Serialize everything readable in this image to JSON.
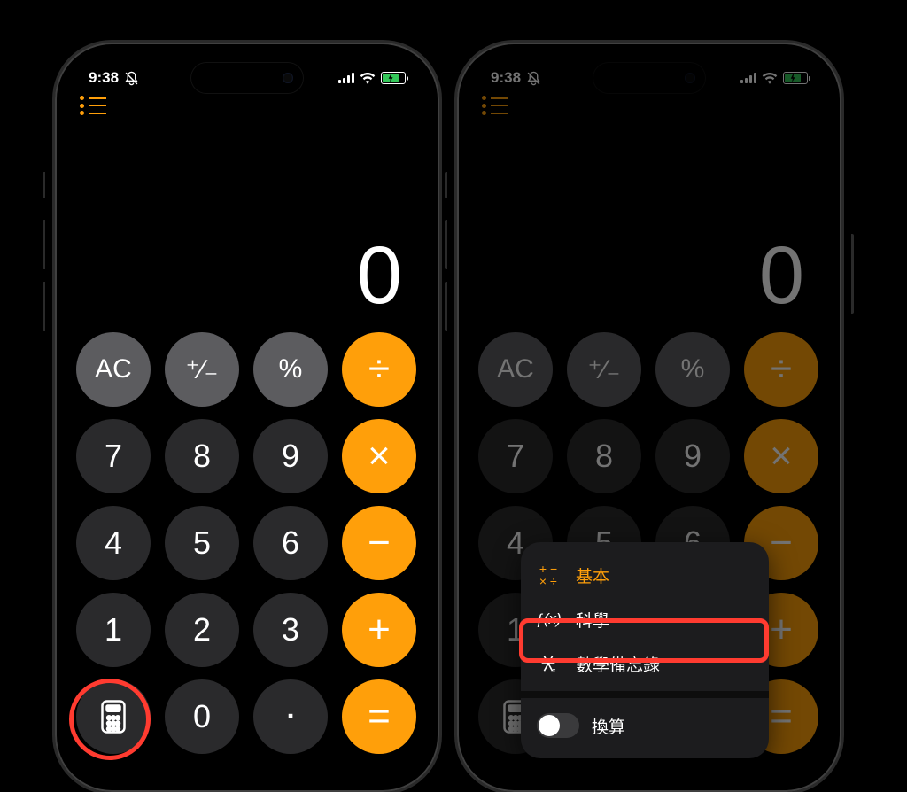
{
  "status": {
    "time": "9:38"
  },
  "display": {
    "value": "0"
  },
  "keys": {
    "ac": "AC",
    "sign": "⁺∕₋",
    "percent": "%",
    "divide": "÷",
    "multiply": "×",
    "minus": "−",
    "plus": "+",
    "equals": "=",
    "n7": "7",
    "n8": "8",
    "n9": "9",
    "n4": "4",
    "n5": "5",
    "n6": "6",
    "n1": "1",
    "n2": "2",
    "n3": "3",
    "n0": "0",
    "dot": "."
  },
  "menu": {
    "basic": {
      "icon": "×÷",
      "label": "基本"
    },
    "scientific": {
      "icon": "ƒ(x)",
      "label": "科學"
    },
    "mathnotes": {
      "icon": "⽊",
      "label": "數學備忘錄"
    },
    "convert": {
      "label": "換算"
    }
  }
}
